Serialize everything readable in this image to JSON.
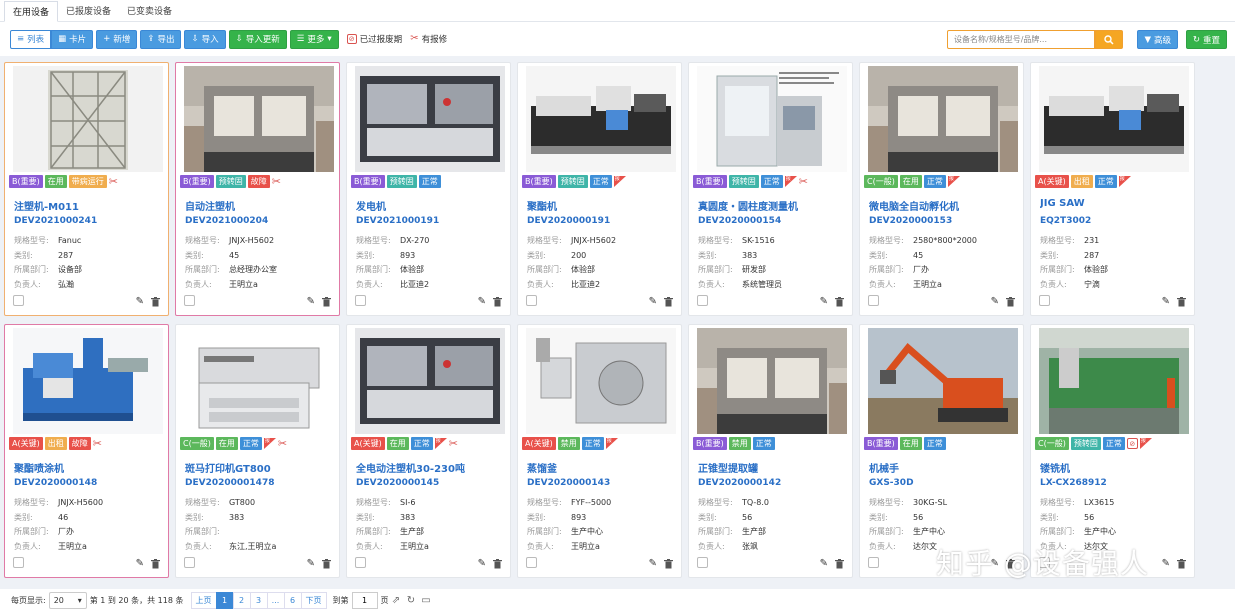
{
  "tabs": [
    "在用设备",
    "已报废设备",
    "已变卖设备"
  ],
  "toolbar": {
    "list": "列表",
    "card": "卡片",
    "add": "新增",
    "export": "导出",
    "import": "导入",
    "import_update": "导入更新",
    "more": "更多",
    "expired": "已过报废期",
    "has_repair": "有报修"
  },
  "search": {
    "placeholder": "设备名称/规格型号/品牌..."
  },
  "advanced": "高级",
  "reset": "重置",
  "field_labels": [
    "规格型号:",
    "类别:",
    "所属部门:",
    "负责人:"
  ],
  "cards": [
    {
      "name": "注塑机-M011",
      "code": "DEV2021000241",
      "tags": [
        {
          "t": "B(重要)",
          "c": "purple"
        },
        {
          "t": "在用",
          "c": "green"
        },
        {
          "t": "带病运行",
          "c": "orange"
        }
      ],
      "extra": [
        "wrench"
      ],
      "model": "Fanuc",
      "category": "287",
      "dept": "设备部",
      "owner": "弘瀚",
      "img": "rack",
      "border": "orange"
    },
    {
      "name": "自动注塑机",
      "code": "DEV2021000204",
      "tags": [
        {
          "t": "B(重要)",
          "c": "purple"
        },
        {
          "t": "预转固",
          "c": "teal"
        },
        {
          "t": "故障",
          "c": "red"
        }
      ],
      "extra": [
        "wrench"
      ],
      "model": "JNJX-H5602",
      "category": "45",
      "dept": "总经理办公室",
      "owner": "王明立a",
      "img": "machine",
      "border": "pink"
    },
    {
      "name": "发电机",
      "code": "DEV2021000191",
      "tags": [
        {
          "t": "B(重要)",
          "c": "purple"
        },
        {
          "t": "预转固",
          "c": "teal"
        },
        {
          "t": "正常",
          "c": "blue"
        }
      ],
      "extra": [],
      "model": "DX-270",
      "category": "893",
      "dept": "体验部",
      "owner": "比亚迪2",
      "img": "smt",
      "border": ""
    },
    {
      "name": "聚酯机",
      "code": "DEV2020000191",
      "tags": [
        {
          "t": "B(重要)",
          "c": "purple"
        },
        {
          "t": "预转固",
          "c": "teal"
        },
        {
          "t": "正常",
          "c": "blue"
        }
      ],
      "extra": [
        "flag"
      ],
      "model": "JNJX-H5602",
      "category": "200",
      "dept": "体验部",
      "owner": "比亚迪2",
      "img": "injection",
      "border": ""
    },
    {
      "name": "真圆度・圆柱度测量机",
      "code": "DEV2020000154",
      "tags": [
        {
          "t": "B(重要)",
          "c": "purple"
        },
        {
          "t": "预转固",
          "c": "teal"
        },
        {
          "t": "正常",
          "c": "blue"
        }
      ],
      "extra": [
        "flag",
        "wrench"
      ],
      "model": "SK-1516",
      "category": "383",
      "dept": "研发部",
      "owner": "系统管理员",
      "img": "measure",
      "border": ""
    },
    {
      "name": "微电脑全自动孵化机",
      "code": "DEV2020000153",
      "tags": [
        {
          "t": "C(一般)",
          "c": "green"
        },
        {
          "t": "在用",
          "c": "green"
        },
        {
          "t": "正常",
          "c": "blue"
        }
      ],
      "extra": [
        "flag"
      ],
      "model": "2580*800*2000",
      "category": "45",
      "dept": "厂办",
      "owner": "王明立a",
      "img": "machine",
      "border": ""
    },
    {
      "name": "JIG SAW",
      "code": "EQ2T3002",
      "tags": [
        {
          "t": "A(关键)",
          "c": "red"
        },
        {
          "t": "出租",
          "c": "orange"
        },
        {
          "t": "正常",
          "c": "blue"
        }
      ],
      "extra": [
        "flag"
      ],
      "model": "231",
      "category": "287",
      "dept": "体验部",
      "owner": "宁滴",
      "img": "injection",
      "border": ""
    },
    {
      "name": "聚酯喷涂机",
      "code": "DEV2020000148",
      "tags": [
        {
          "t": "A(关键)",
          "c": "red"
        },
        {
          "t": "出租",
          "c": "orange"
        },
        {
          "t": "故障",
          "c": "red"
        }
      ],
      "extra": [
        "wrench"
      ],
      "model": "JNJX-H5600",
      "category": "46",
      "dept": "厂办",
      "owner": "王明立a",
      "img": "bluemachine",
      "border": "pink"
    },
    {
      "name": "斑马打印机GT800",
      "code": "DEV20200001478",
      "tags": [
        {
          "t": "C(一般)",
          "c": "green"
        },
        {
          "t": "在用",
          "c": "green"
        },
        {
          "t": "正常",
          "c": "blue"
        }
      ],
      "extra": [
        "flag",
        "wrench"
      ],
      "model": "GT800",
      "category": "383",
      "dept": "",
      "owner": "东江,王明立a",
      "img": "copier",
      "border": ""
    },
    {
      "name": "全电动注塑机30-230吨",
      "code": "DEV2020000145",
      "tags": [
        {
          "t": "A(关键)",
          "c": "red"
        },
        {
          "t": "在用",
          "c": "green"
        },
        {
          "t": "正常",
          "c": "blue"
        }
      ],
      "extra": [
        "flag",
        "wrench"
      ],
      "model": "SI-6",
      "category": "383",
      "dept": "生产部",
      "owner": "王明立a",
      "img": "smt",
      "border": ""
    },
    {
      "name": "蒸馏釜",
      "code": "DEV2020000143",
      "tags": [
        {
          "t": "A(关键)",
          "c": "red"
        },
        {
          "t": "禁用",
          "c": "green"
        },
        {
          "t": "正常",
          "c": "blue"
        }
      ],
      "extra": [
        "flag"
      ],
      "model": "FYF--5000",
      "category": "893",
      "dept": "生产中心",
      "owner": "王明立a",
      "img": "filler",
      "border": ""
    },
    {
      "name": "正锥型提取罐",
      "code": "DEV2020000142",
      "tags": [
        {
          "t": "B(重要)",
          "c": "purple"
        },
        {
          "t": "禁用",
          "c": "green"
        },
        {
          "t": "正常",
          "c": "blue"
        }
      ],
      "extra": [],
      "model": "TQ-8.0",
      "category": "56",
      "dept": "生产部",
      "owner": "张飒",
      "img": "machine",
      "border": ""
    },
    {
      "name": "机械手",
      "code": "GXS-30D",
      "tags": [
        {
          "t": "B(重要)",
          "c": "purple"
        },
        {
          "t": "在用",
          "c": "green"
        },
        {
          "t": "正常",
          "c": "blue"
        }
      ],
      "extra": [],
      "model": "30KG-SL",
      "category": "56",
      "dept": "生产中心",
      "owner": "达尔文",
      "img": "excavator",
      "border": ""
    },
    {
      "name": "镂铣机",
      "code": "LX-CX268912",
      "tags": [
        {
          "t": "C(一般)",
          "c": "green"
        },
        {
          "t": "预转固",
          "c": "teal"
        },
        {
          "t": "正常",
          "c": "blue"
        }
      ],
      "extra": [
        "ban",
        "flag"
      ],
      "model": "LX3615",
      "category": "56",
      "dept": "生产中心",
      "owner": "达尔文",
      "img": "factory",
      "border": ""
    }
  ],
  "pager": {
    "per_page_label": "每页显示:",
    "per_page": "20",
    "range_text": "第 1 到 20 条，共 118 条",
    "prev": "上页",
    "pages": [
      "1",
      "2",
      "3",
      "...",
      "6"
    ],
    "next": "下页",
    "goto": "到第",
    "goto_value": "1",
    "page_unit": "页"
  },
  "watermark": "知乎 @设备强人"
}
